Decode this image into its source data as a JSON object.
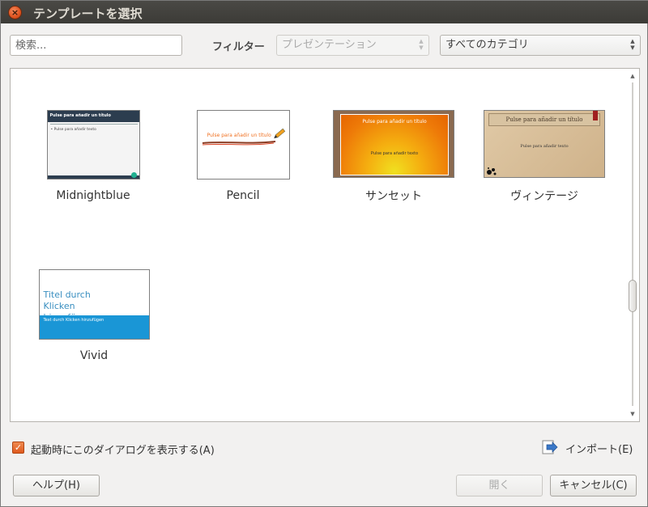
{
  "window": {
    "title": "テンプレートを選択",
    "close_glyph": "×"
  },
  "search": {
    "placeholder": "検索..."
  },
  "filter": {
    "label": "フィルター",
    "type_value": "プレゼンテーション",
    "category_value": "すべてのカテゴリ"
  },
  "templates": [
    {
      "name": "Midnightblue",
      "preview_title": "Pulse para añadir un título",
      "preview_text": "• Pulse para añadir texto"
    },
    {
      "name": "Pencil",
      "preview_title": "Pulse para añadir un título"
    },
    {
      "name": "サンセット",
      "preview_title": "Pulse para añadir un título",
      "preview_text": "Pulse para añadir texto"
    },
    {
      "name": "ヴィンテージ",
      "preview_title": "Pulse para añadir un título",
      "preview_text": "Pulse para añadir texto"
    },
    {
      "name": "Vivid",
      "preview_title": "Titel durch Klicken hinzufügen",
      "preview_text": "Text durch Klicken hinzufügen"
    }
  ],
  "options": {
    "show_on_startup_label": "起動時にこのダイアログを表示する(A)",
    "show_on_startup_checked": true
  },
  "buttons": {
    "import": "インポート(E)",
    "help": "ヘルプ(H)",
    "open": "開く",
    "cancel": "キャンセル(C)"
  },
  "colors": {
    "accent": "#df5a1e",
    "titlebar": "#3c3b37"
  }
}
